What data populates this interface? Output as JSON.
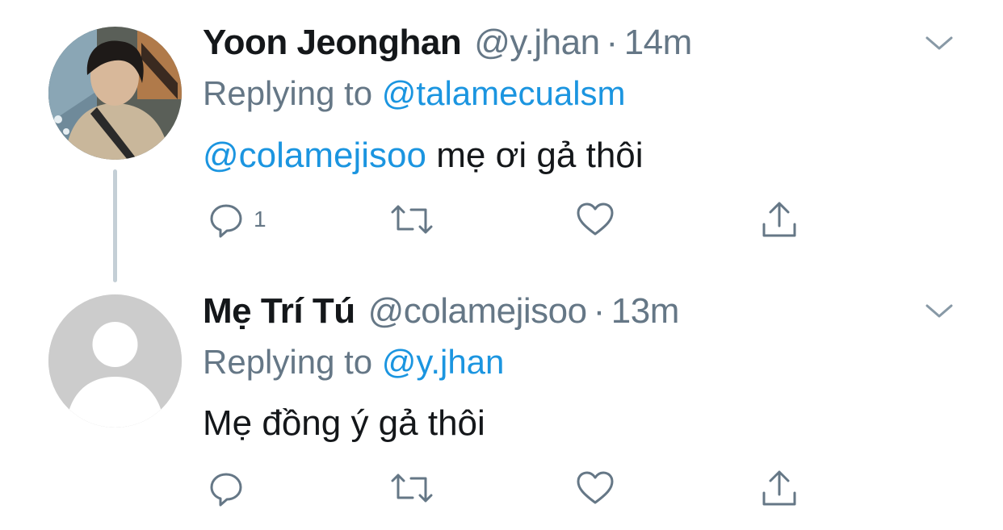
{
  "tweets": [
    {
      "name": "Yoon Jeonghan",
      "handle": "@y.jhan",
      "separator": "·",
      "time": "14m",
      "replying_prefix": "Replying to",
      "replying_to": "@talamecualsm",
      "mention": "@colamejisoo",
      "text": " mẹ ơi gả thôi",
      "reply_count": "1",
      "avatar": "profile-photo"
    },
    {
      "name": "Mẹ Trí Tú",
      "handle": "@colamejisoo",
      "separator": "·",
      "time": "13m",
      "replying_prefix": "Replying to",
      "replying_to": "@y.jhan",
      "text": "Mẹ đồng ý gả thôi",
      "avatar": "default-avatar"
    }
  ],
  "icons": {
    "reply": "reply-icon",
    "retweet": "retweet-icon",
    "like": "heart-icon",
    "share": "share-icon",
    "menu": "chevron-down-icon"
  },
  "colors": {
    "text": "#14171a",
    "muted": "#657786",
    "link": "#1b95e0",
    "thread_line": "#c4cfd6",
    "default_avatar": "#cccccc"
  }
}
